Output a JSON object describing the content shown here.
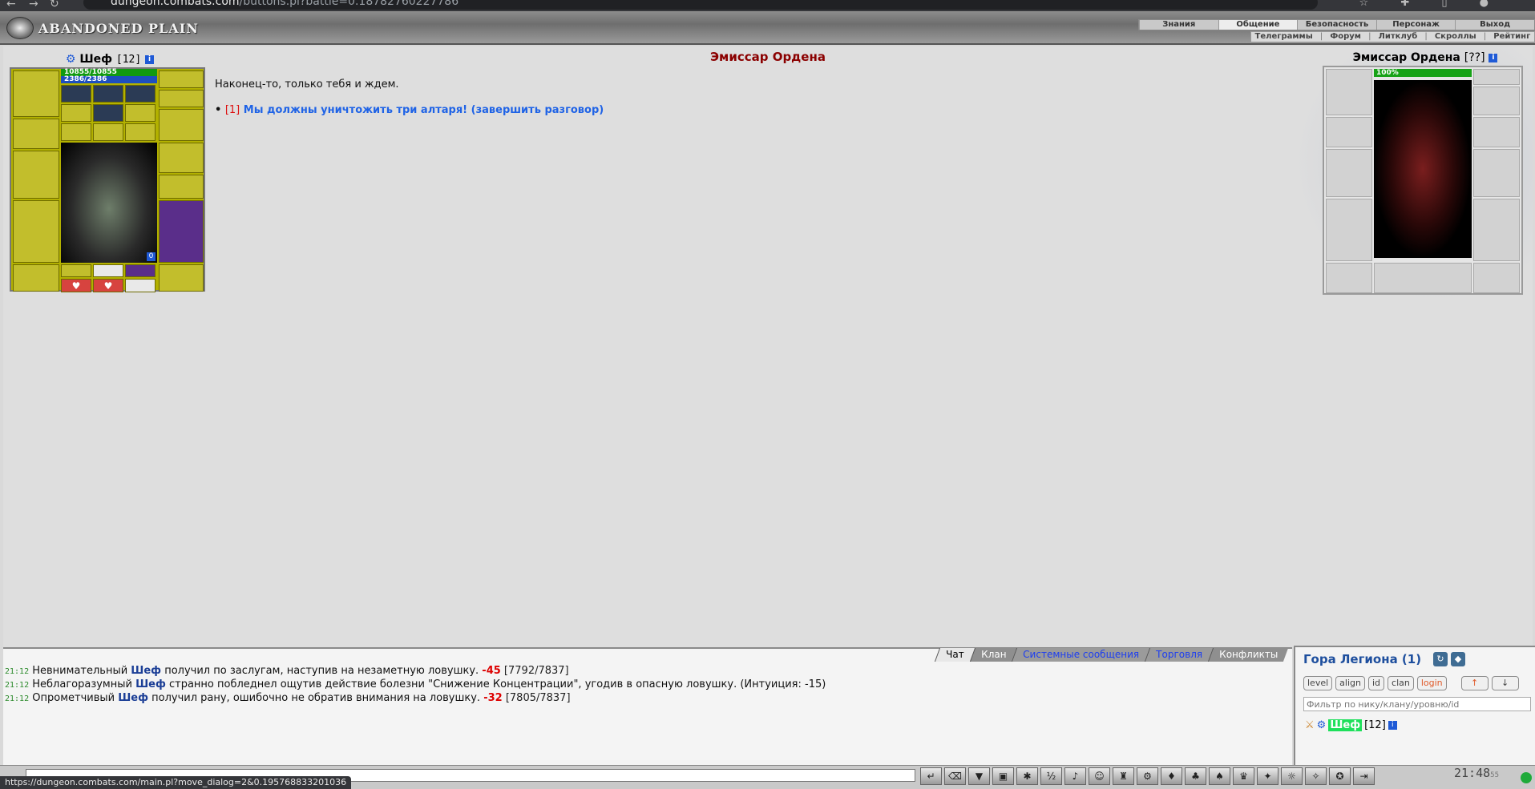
{
  "browser": {
    "url_host": "dungeon.combats.com",
    "url_path": "/buttons.pl?battle=0.18782760227786",
    "status_url": "https://dungeon.combats.com/main.pl?move_dialog=2&0.195768833201036"
  },
  "header": {
    "logo_text": "ABANDONED PLAIN",
    "menu": [
      "Знания",
      "Общение",
      "Безопасность",
      "Персонаж",
      "Выход"
    ],
    "menu_active": "Общение",
    "submenu": [
      "Телеграммы",
      "Форум",
      "Литклуб",
      "Скроллы",
      "Рейтинг"
    ]
  },
  "player": {
    "name": "Шеф",
    "level": "[12]",
    "info": "i",
    "hp": "10855/10855",
    "mp": "2386/2386",
    "slot_badge": "0"
  },
  "dialog": {
    "title": "Эмиссар Ордена",
    "text": "Наконец-то, только тебя и ждем.",
    "option_bullet": "•",
    "option_num": "[1]",
    "option_text": "Мы должны уничтожить три алтаря! (завершить разговор)"
  },
  "npc": {
    "name": "Эмиссар Ордена",
    "level": "[??]",
    "info": "i",
    "hp": "100%"
  },
  "chat": {
    "tabs": [
      "Чат",
      "Клан",
      "Системные сообщения",
      "Торговля",
      "Конфликты"
    ],
    "lines": [
      {
        "time": "21:12",
        "pre": "Невнимательный ",
        "nick": "Шеф",
        "post": " получил по заслугам, наступив на незаметную ловушку. ",
        "dmg": "-45",
        "hp": " [7792/7837]"
      },
      {
        "time": "21:12",
        "pre": "Неблагоразумный ",
        "nick": "Шеф",
        "post": " странно побледнел ощутив действие болезни \"Снижение Концентрации\", угодив в опасную ловушку. (Интуиция: -15)",
        "dmg": "",
        "hp": ""
      },
      {
        "time": "21:12",
        "pre": "Опрометчивый ",
        "nick": "Шеф",
        "post": " получил рану, ошибочно не обратив внимания на ловушку. ",
        "dmg": "-32",
        "hp": " [7805/7837]"
      }
    ]
  },
  "location": {
    "title": "Гора Легиона (1)",
    "filters": [
      "level",
      "align",
      "id",
      "clan",
      "login"
    ],
    "sort_up": "↑",
    "sort_down": "↓",
    "filter_placeholder": "Фильтр по нику/клану/уровню/id",
    "users": [
      {
        "nick": "Шеф",
        "level": "[12]",
        "info": "i"
      }
    ]
  },
  "bottombar": {
    "clock": "21:48",
    "clock_sec": "55"
  }
}
